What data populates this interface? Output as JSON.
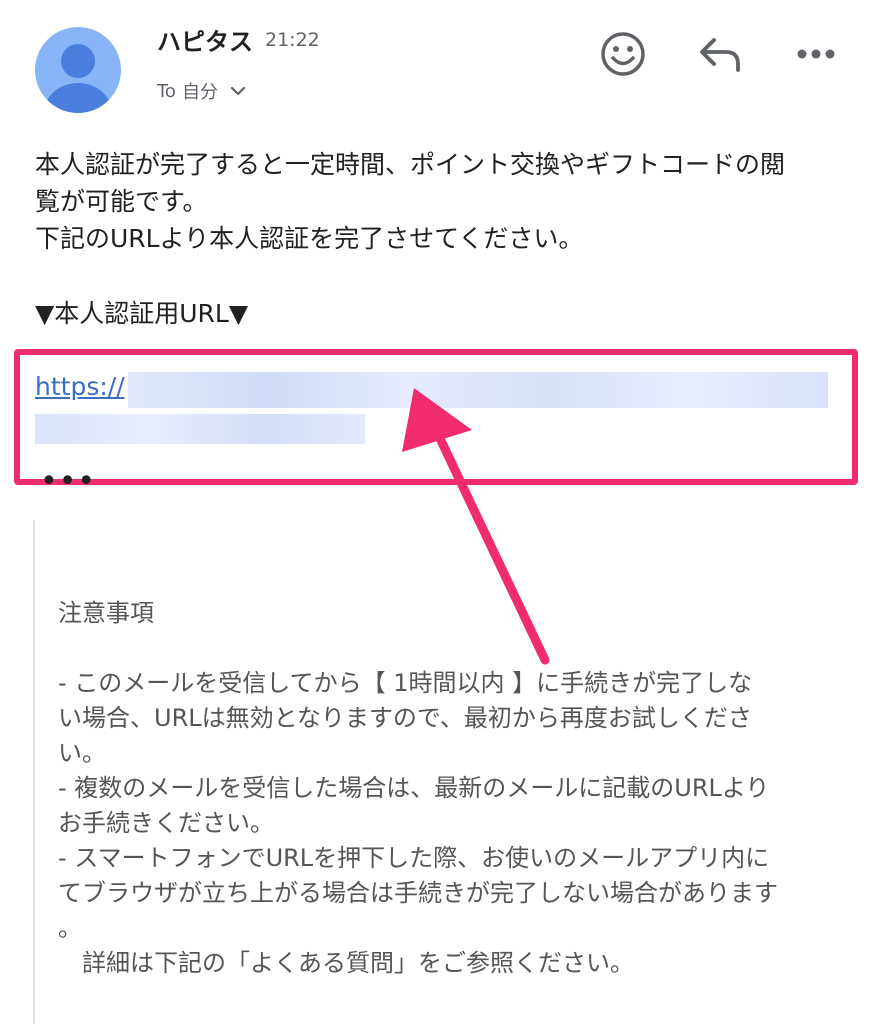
{
  "header": {
    "sender": "ハピタス",
    "time": "21:22",
    "to_prefix": "To",
    "to_recipient": "自分"
  },
  "icons": {
    "avatar": "person-avatar-icon",
    "emoji": "emoji-react-icon",
    "reply": "reply-icon",
    "more": "more-options-icon",
    "expand": "chevron-down-icon"
  },
  "body": {
    "line1": "本人認証が完了すると一定時間、ポイント交換やギフトコードの閲",
    "line2": "覧が可能です。",
    "line3": "下記のURLより本人認証を完了させてください。",
    "url_heading": "▼本人認証用URL▼",
    "link_visible": "https://",
    "ellipsis": "•••"
  },
  "notice": {
    "title": "注意事項",
    "lines": [
      "- このメールを受信してから【 1時間以内 】に手続きが完了しな",
      "い場合、URLは無効となりますので、最初から再度お試しくださ",
      "い。",
      "- 複数のメールを受信した場合は、最新のメールに記載のURLより",
      "お手続きください。",
      "- スマートフォンでURLを押下した際、お使いのメールアプリ内に",
      "てブラウザが立ち上がる場合は手続きが完了しない場合があります",
      "。",
      "　詳細は下記の「よくある質問」をご参照ください。"
    ]
  },
  "colors": {
    "highlight": "#f02c6f",
    "link": "#3b6cc4",
    "avatar_bg": "#8ab4f8",
    "avatar_fg": "#4a7fe0"
  }
}
